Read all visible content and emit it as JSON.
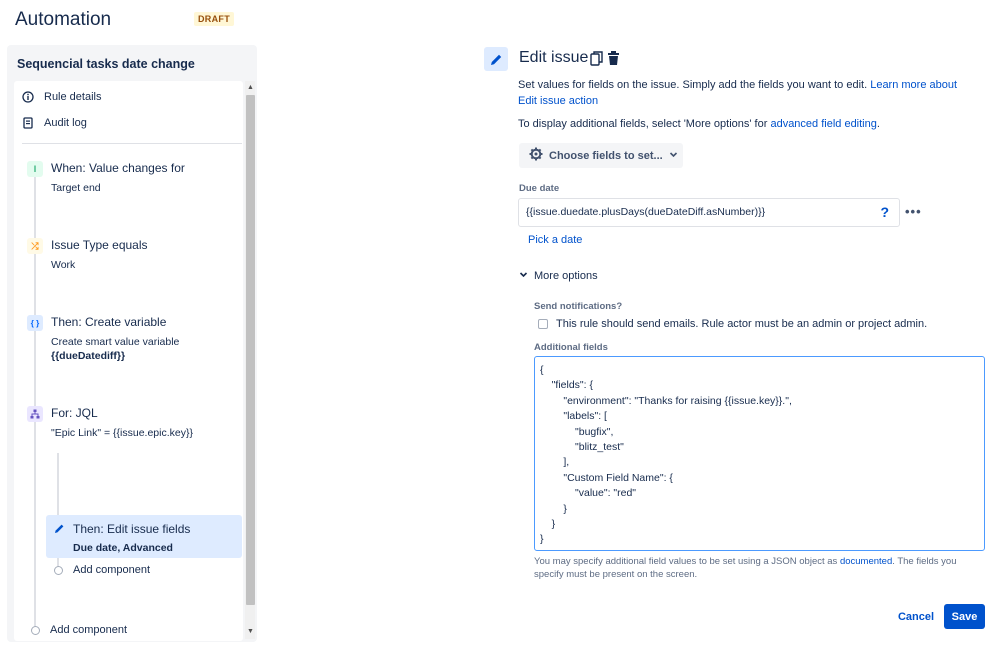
{
  "header": {
    "title": "Automation",
    "badge": "DRAFT"
  },
  "rule": {
    "name": "Sequencial tasks date change",
    "menu": [
      {
        "label": "Rule details",
        "icon": "info-icon"
      },
      {
        "label": "Audit log",
        "icon": "document-icon"
      }
    ],
    "steps": [
      {
        "title": "When: Value changes for",
        "sub": "Target end",
        "icon": "trigger-icon",
        "icon_color": "#36b37e",
        "icon_bg": "#e3fcef"
      },
      {
        "title": "Issue Type equals",
        "sub": "Work",
        "icon": "condition-icon",
        "icon_color": "#ff991f",
        "icon_bg": "#fffae6"
      },
      {
        "title": "Then: Create variable",
        "sub": "Create smart value variable",
        "sub2": "{{dueDatediff}}",
        "icon": "variable-icon",
        "icon_color": "#0065ff",
        "icon_bg": "#deebff"
      },
      {
        "title": "For: JQL",
        "sub": "\"Epic Link\" = {{issue.epic.key}}",
        "icon": "branch-icon",
        "icon_color": "#6554c0",
        "icon_bg": "#eae6ff"
      }
    ],
    "active_step": {
      "title": "Then: Edit issue fields",
      "sub": "Due date, Advanced"
    },
    "add_component_inner": "Add component",
    "add_component_outer": "Add component"
  },
  "editor": {
    "title": "Edit issue",
    "desc_text": "Set values for fields on the issue. Simply add the fields you want to edit. ",
    "desc_link": "Learn more about Edit issue action",
    "desc2_text": "To display additional fields, select 'More options' for ",
    "desc2_link": "advanced field editing",
    "desc2_end": ".",
    "choose_button": "Choose fields to set...",
    "due_date_label": "Due date",
    "due_date_value": "{{issue.duedate.plusDays(dueDateDiff.asNumber)}}",
    "help_glyph": "?",
    "more_glyph": "•••",
    "pick_date": "Pick a date",
    "more_options": "More options",
    "send_notifications_label": "Send notifications?",
    "send_notifications_text": "This rule should send emails. Rule actor must be an admin or project admin.",
    "additional_fields_label": "Additional fields",
    "additional_fields_value": "{\n    \"fields\": {\n        \"environment\": \"Thanks for raising {{issue.key}}.\",\n        \"labels\": [\n            \"bugfix\",\n            \"blitz_test\"\n        ],\n        \"Custom Field Name\": {\n            \"value\": \"red\"\n        }\n    }\n}",
    "note_text": "You may specify additional field values to be set using a JSON object as ",
    "note_link": "documented",
    "note_end": ". The fields you specify must be present on the screen.",
    "cancel": "Cancel",
    "save": "Save"
  }
}
